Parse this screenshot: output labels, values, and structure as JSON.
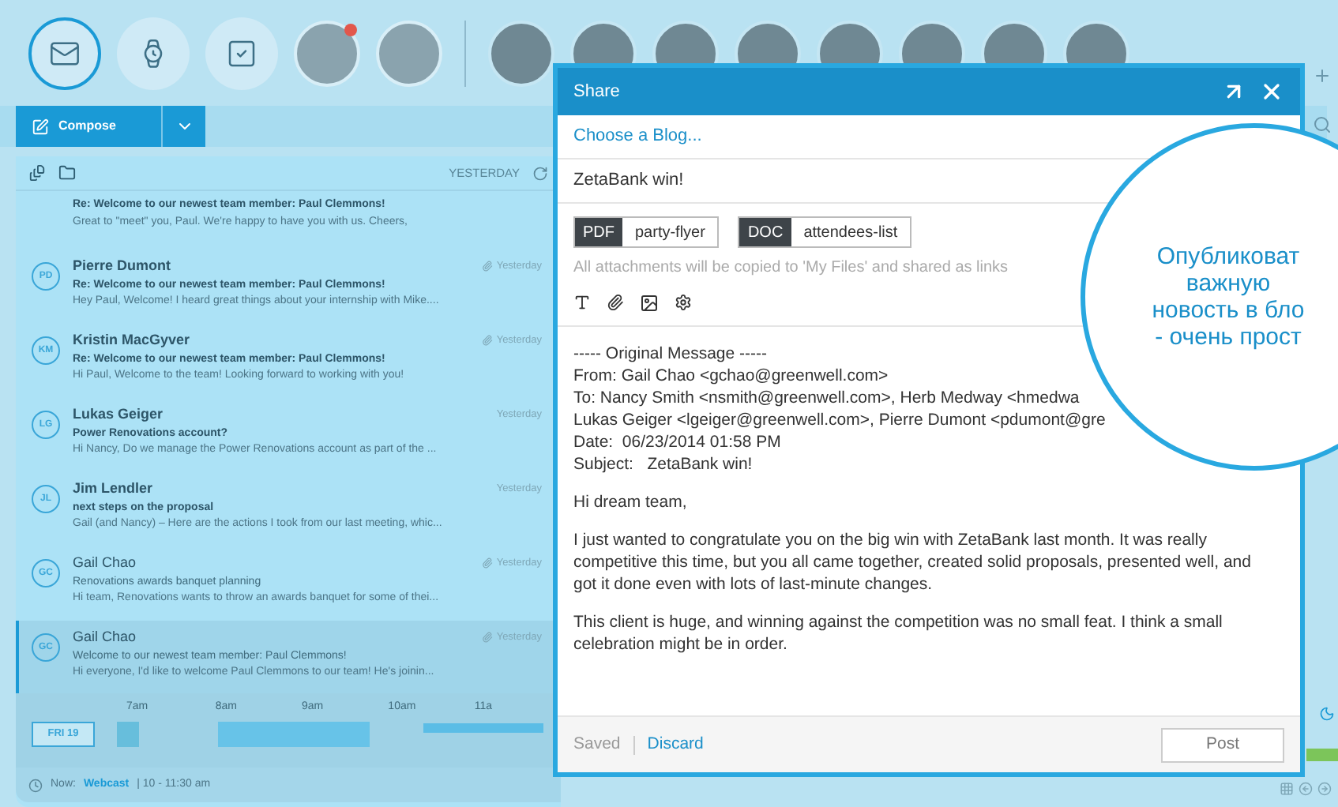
{
  "top_bar": {
    "icons": [
      {
        "kind": "mail",
        "selected": true
      },
      {
        "kind": "watch",
        "selected": false
      },
      {
        "kind": "tasks",
        "selected": false
      }
    ],
    "contacts": [
      {
        "notification": true,
        "pinned": true
      },
      {
        "notification": false,
        "pinned": true
      },
      {
        "notification": false,
        "pinned": false
      },
      {
        "notification": false,
        "pinned": false
      },
      {
        "notification": false,
        "pinned": false
      },
      {
        "notification": false,
        "pinned": false
      },
      {
        "notification": false,
        "pinned": false
      },
      {
        "notification": false,
        "pinned": false
      },
      {
        "notification": false,
        "pinned": false
      },
      {
        "notification": false,
        "pinned": false
      }
    ]
  },
  "toolbar": {
    "compose": "Compose"
  },
  "list_header": {
    "label": "YESTERDAY"
  },
  "emails": [
    {
      "subject": "Re: Welcome to our newest team member: Paul Clemmons!",
      "preview": "Great to \"meet\" you, Paul. We're happy to have you with us. Cheers,",
      "unread": true,
      "selected": false
    },
    {
      "initials": "PD",
      "sender": "Pierre Dumont",
      "subject": "Re: Welcome to our newest team member: Paul Clemmons!",
      "preview": "Hey Paul, Welcome! I heard great things about your internship with Mike....",
      "time": "Yesterday",
      "unread": true,
      "attachment": true,
      "selected": false
    },
    {
      "initials": "KM",
      "sender": "Kristin MacGyver",
      "subject": "Re: Welcome to our newest team member: Paul Clemmons!",
      "preview": "Hi Paul, Welcome to the team! Looking forward to working with you!",
      "time": "Yesterday",
      "unread": true,
      "attachment": true,
      "selected": false
    },
    {
      "initials": "LG",
      "sender": "Lukas Geiger",
      "subject": "Power Renovations account?",
      "preview": "Hi Nancy, Do we manage the Power Renovations account as part of the ...",
      "time": "Yesterday",
      "unread": true,
      "attachment": false,
      "selected": false
    },
    {
      "initials": "JL",
      "sender": "Jim Lendler",
      "subject": "next steps on the proposal",
      "preview": "Gail (and Nancy) – Here are the actions I took from our last meeting, whic...",
      "time": "Yesterday",
      "unread": true,
      "attachment": false,
      "selected": false
    },
    {
      "initials": "GC",
      "sender": "Gail Chao",
      "subject": "Renovations awards banquet planning",
      "preview": "Hi team, Renovations wants to throw an awards banquet for some of thei...",
      "time": "Yesterday",
      "unread": false,
      "attachment": true,
      "selected": false
    },
    {
      "initials": "GC",
      "sender": "Gail Chao",
      "subject": "Welcome to our newest team member: Paul Clemmons!",
      "preview": "Hi everyone, I'd like to welcome Paul Clemmons to our team! He's joinin...",
      "time": "Yesterday",
      "unread": false,
      "attachment": true,
      "selected": true
    }
  ],
  "timeline": {
    "hours": [
      "7am",
      "8am",
      "9am",
      "10am",
      "11a"
    ],
    "day": "FRI 19"
  },
  "status_bar": {
    "now": "Now:",
    "event": "Webcast",
    "time": "| 10 - 11:30 am"
  },
  "share_dialog": {
    "title": "Share",
    "blog": "Choose a Blog...",
    "subject": "ZetaBank win!",
    "attachments": [
      {
        "type": "PDF",
        "name": "party-flyer"
      },
      {
        "type": "DOC",
        "name": "attendees-list"
      }
    ],
    "note": "All attachments will be copied to 'My Files' and shared as links",
    "header_lines": [
      "----- Original Message -----",
      "From: Gail Chao <gchao@greenwell.com>",
      "To: Nancy Smith <nsmith@greenwell.com>, Herb Medway <hmedwa",
      "Lukas Geiger <lgeiger@greenwell.com>, Pierre Dumont <pdumont@gre",
      "Date:  06/23/2014 01:58 PM",
      "Subject:   ZetaBank win!"
    ],
    "paragraphs": [
      "Hi dream team,",
      "I just wanted to congratulate you on the big win with ZetaBank last month. It was really competitive this time, but you all came together, created solid proposals, presented well, and got it done even with lots of last-minute changes.",
      "This client is huge, and winning against the competition was no small feat. I think a small celebration might be in order."
    ],
    "saved": "Saved",
    "discard": "Discard",
    "post": "Post"
  },
  "callout": {
    "lines": [
      "Опубликоват",
      "важную",
      "новость в бло",
      "- очень прост"
    ]
  }
}
